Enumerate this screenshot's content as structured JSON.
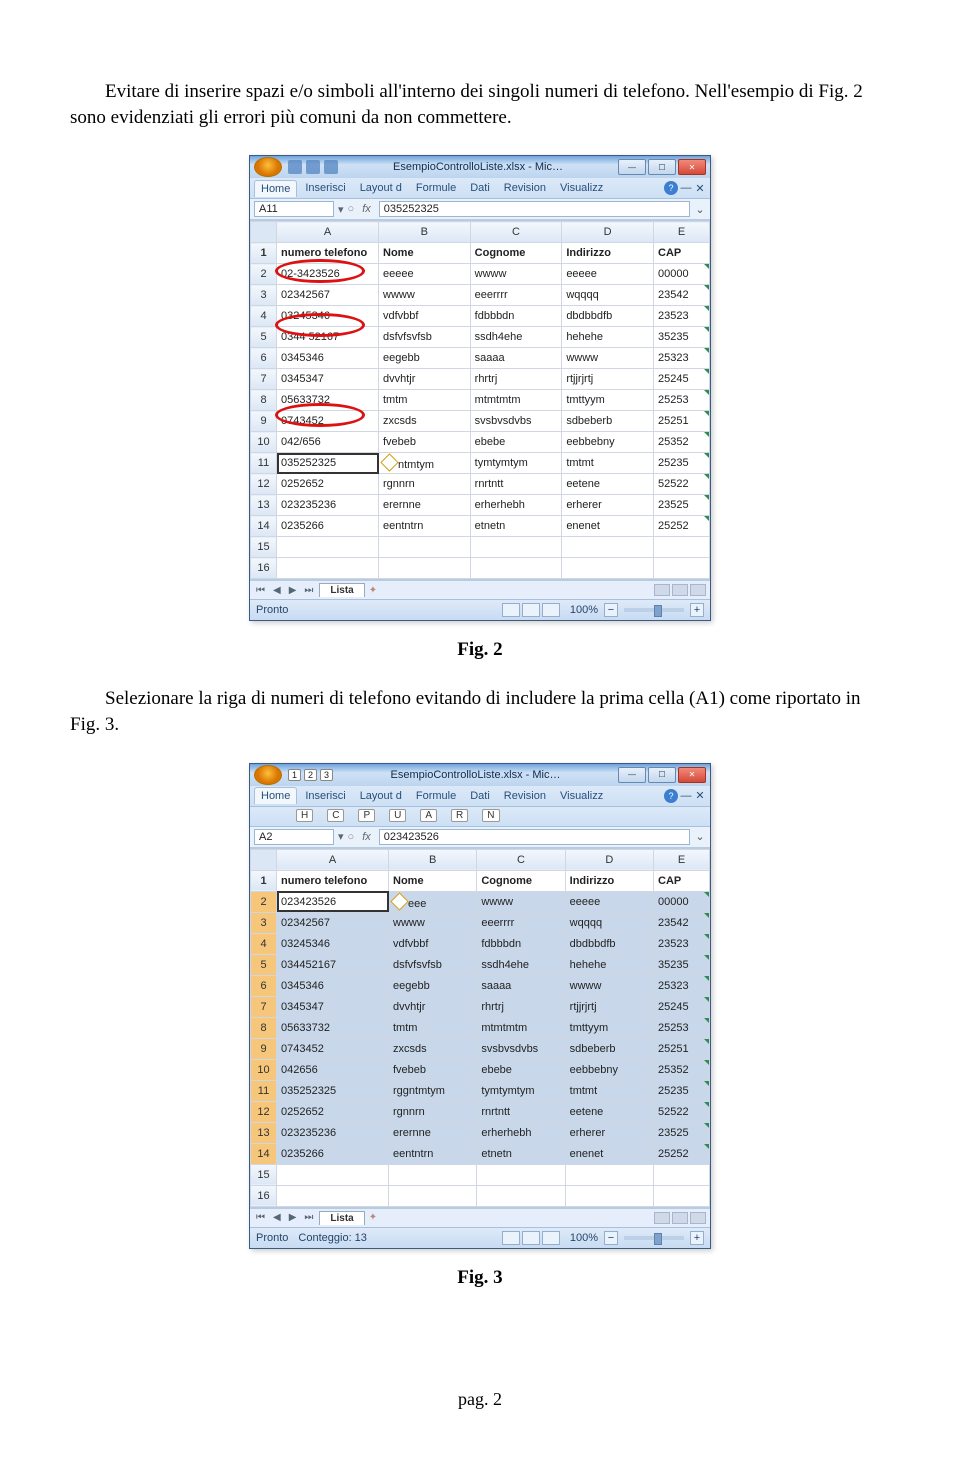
{
  "para1": "Evitare di inserire spazi e/o simboli all'interno dei singoli numeri di telefono. Nell'esempio di Fig. 2 sono evidenziati gli errori più comuni da non commettere.",
  "fig2_caption": "Fig. 2",
  "para2": "Selezionare la riga di numeri di telefono evitando di includere la prima cella (A1) come riportato in Fig. 3.",
  "fig3_caption": "Fig. 3",
  "page_num": "pag. 2",
  "excel": {
    "title": "EsempioControlloListe.xlsx - Mic…",
    "tabs": [
      "Home",
      "Inserisci",
      "Layout d",
      "Formule",
      "Dati",
      "Revision",
      "Visualizz"
    ],
    "sheet_tab": "Lista",
    "status_ready": "Pronto",
    "status_count": "Conteggio: 13",
    "zoom": "100%",
    "col_letters": [
      "A",
      "B",
      "C",
      "D",
      "E"
    ],
    "headers": [
      "numero telefono",
      "Nome",
      "Cognome",
      "Indirizzo",
      "CAP"
    ]
  },
  "fig2": {
    "namebox": "A11",
    "formula": "035252325",
    "rows": [
      [
        "02-3423526",
        "eeeee",
        "wwww",
        "eeeee",
        "00000"
      ],
      [
        "02342567",
        "wwww",
        "eeerrrr",
        "wqqqq",
        "23542"
      ],
      [
        "03245346",
        "vdfvbbf",
        "fdbbbdn",
        "dbdbbdfb",
        "23523"
      ],
      [
        "0344 52167",
        "dsfvfsvfsb",
        "ssdh4ehe",
        "hehehe",
        "35235"
      ],
      [
        "0345346",
        "eegebb",
        "saaaa",
        "wwww",
        "25323"
      ],
      [
        "0345347",
        "dvvhtjr",
        "rhrtrj",
        "rtjjrjrtj",
        "25245"
      ],
      [
        "05633732",
        "tmtm",
        "mtmtmtm",
        "tmttyym",
        "25253"
      ],
      [
        "0743452",
        "zxcsds",
        "svsbvsdvbs",
        "sdbeberb",
        "25251"
      ],
      [
        "042/656",
        "fvebeb",
        "ebebe",
        "eebbebny",
        "25352"
      ],
      [
        "035252325",
        "ntmtym",
        "tymtymtym",
        "tmtmt",
        "25235"
      ],
      [
        "0252652",
        "rgnnrn",
        "rnrtntt",
        "eetene",
        "52522"
      ],
      [
        "023235236",
        "erernne",
        "erherhebh",
        "erherer",
        "23525"
      ],
      [
        "0235266",
        "eentntrn",
        "etnetn",
        "enenet",
        "25252"
      ]
    ]
  },
  "fig3": {
    "namebox": "A2",
    "formula": "023423526",
    "hint_nums": [
      "1",
      "2",
      "3"
    ],
    "hint_letters": [
      "H",
      "C",
      "P",
      "U",
      "A",
      "R",
      "N"
    ],
    "rows": [
      [
        "023423526",
        "eee",
        "wwww",
        "eeeee",
        "00000"
      ],
      [
        "02342567",
        "wwww",
        "eeerrrr",
        "wqqqq",
        "23542"
      ],
      [
        "03245346",
        "vdfvbbf",
        "fdbbbdn",
        "dbdbbdfb",
        "23523"
      ],
      [
        "034452167",
        "dsfvfsvfsb",
        "ssdh4ehe",
        "hehehe",
        "35235"
      ],
      [
        "0345346",
        "eegebb",
        "saaaa",
        "wwww",
        "25323"
      ],
      [
        "0345347",
        "dvvhtjr",
        "rhrtrj",
        "rtjjrjrtj",
        "25245"
      ],
      [
        "05633732",
        "tmtm",
        "mtmtmtm",
        "tmttyym",
        "25253"
      ],
      [
        "0743452",
        "zxcsds",
        "svsbvsdvbs",
        "sdbeberb",
        "25251"
      ],
      [
        "042656",
        "fvebeb",
        "ebebe",
        "eebbebny",
        "25352"
      ],
      [
        "035252325",
        "rggntmtym",
        "tymtymtym",
        "tmtmt",
        "25235"
      ],
      [
        "0252652",
        "rgnnrn",
        "rnrtntt",
        "eetene",
        "52522"
      ],
      [
        "023235236",
        "erernne",
        "erherhebh",
        "erherer",
        "23525"
      ],
      [
        "0235266",
        "eentntrn",
        "etnetn",
        "enenet",
        "25252"
      ]
    ]
  }
}
